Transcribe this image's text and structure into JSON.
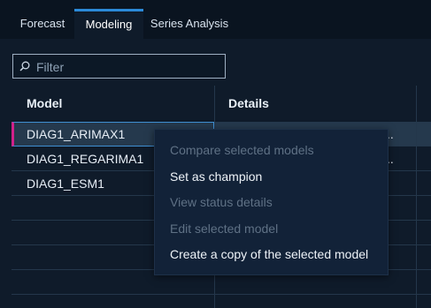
{
  "tabs": [
    {
      "label": "Forecast"
    },
    {
      "label": "Modeling"
    },
    {
      "label": "Series Analysis"
    }
  ],
  "active_tab": "Modeling",
  "filter": {
    "placeholder": "Filter",
    "value": ""
  },
  "table": {
    "columns": [
      "Model",
      "Details"
    ],
    "rows": [
      {
        "model": "DIAG1_ARIMAX1",
        "details": "..",
        "selected": true
      },
      {
        "model": "DIAG1_REGARIMA1",
        "details": ".."
      },
      {
        "model": "DIAG1_ESM1",
        "details": ""
      }
    ]
  },
  "context_menu": {
    "items": [
      {
        "label": "Compare selected models",
        "enabled": false
      },
      {
        "label": "Set as champion",
        "enabled": true
      },
      {
        "label": "View status details",
        "enabled": false
      },
      {
        "label": "Edit selected model",
        "enabled": false
      },
      {
        "label": "Create a copy of the selected model",
        "enabled": true
      }
    ]
  },
  "colors": {
    "background": "#0f1b2a",
    "tab_accent": "#2b8ad8",
    "selection_marker": "#d1218a",
    "selected_row": "#25394d",
    "menu_background": "#122238"
  }
}
